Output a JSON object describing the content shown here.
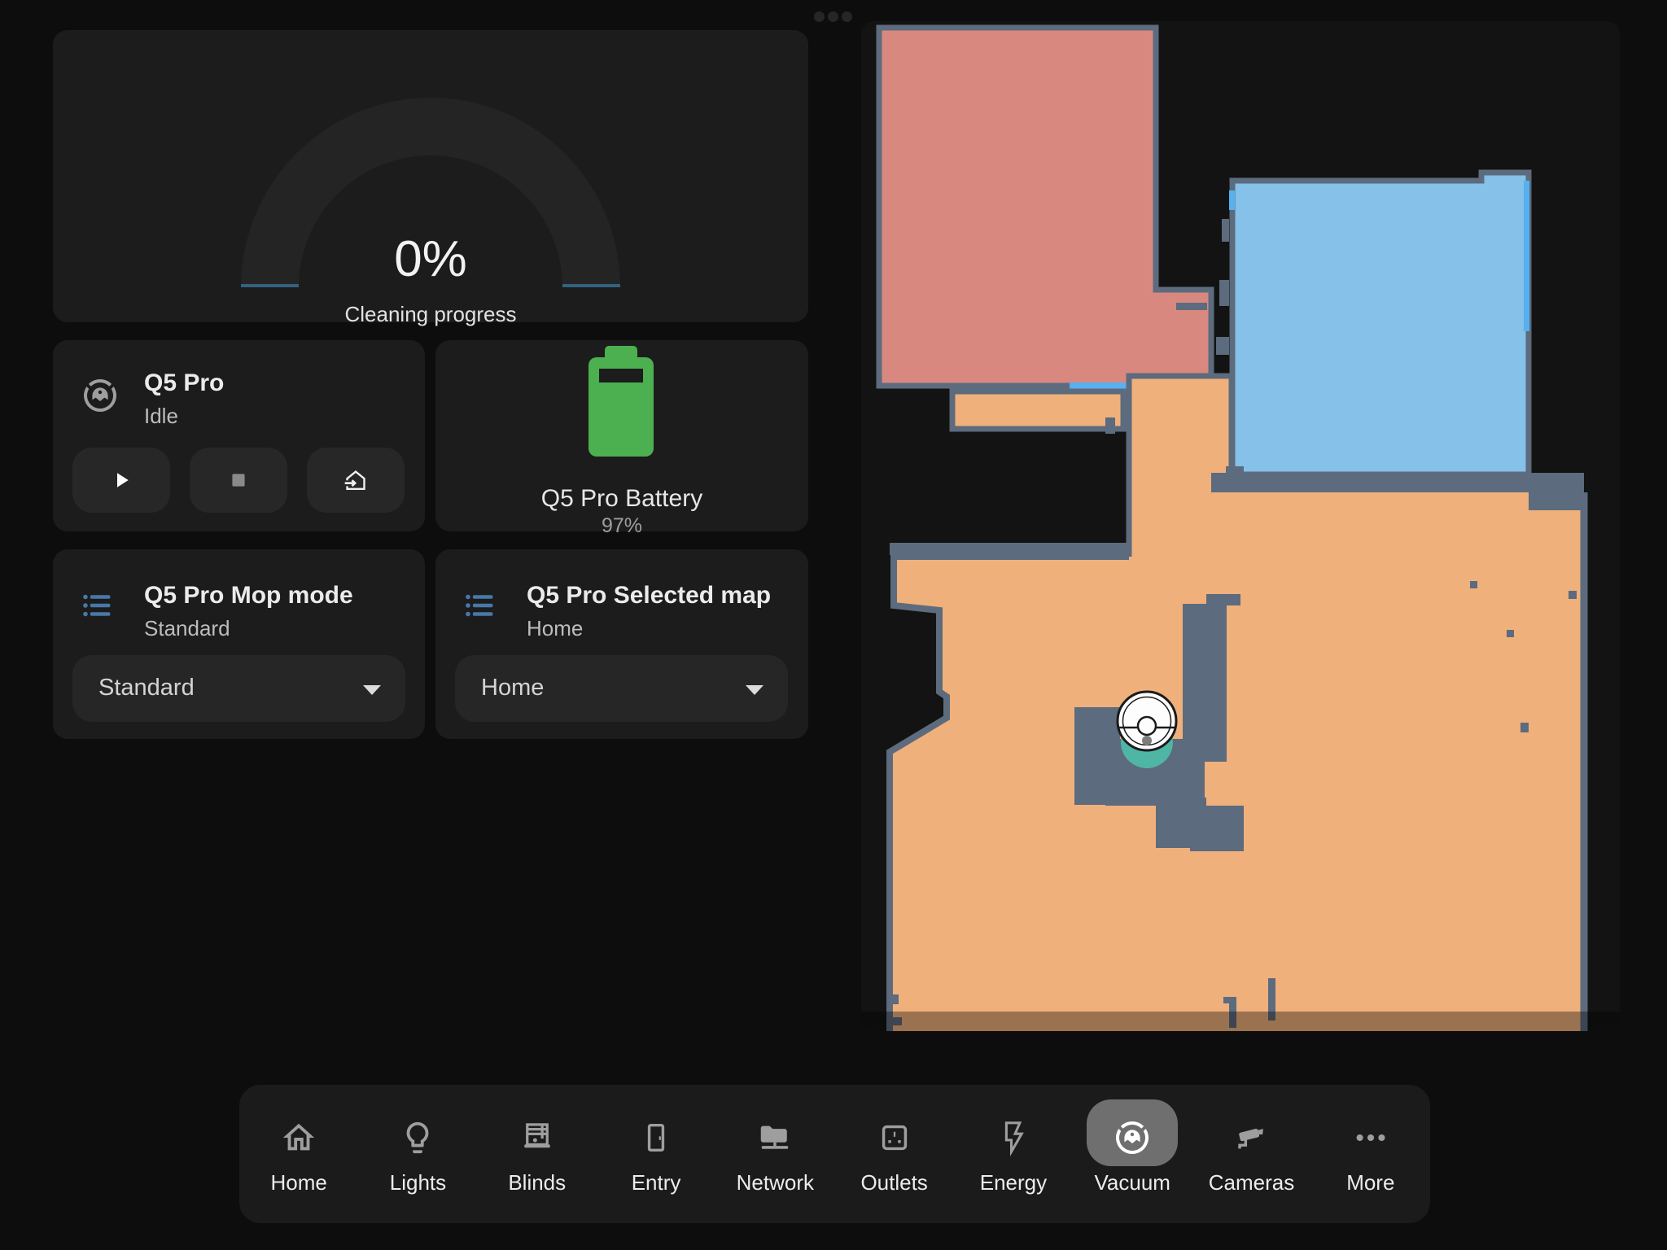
{
  "theme": {
    "page_bg": "#0d0d0d",
    "card_bg": "#1c1c1c",
    "control_bg": "#262626",
    "text_primary": "#e9e9e9",
    "text_secondary": "#bdbdbd",
    "icon_gray": "#9e9e9e"
  },
  "header": {
    "page_indicator_dots": 3
  },
  "gauge_card": {
    "value": "0%",
    "label": "Cleaning progress",
    "ring_color": "#242424",
    "accent_color": "#33627f"
  },
  "vacuum_card": {
    "name": "Q5 Pro",
    "status": "Idle",
    "controls": [
      {
        "name": "start",
        "icon": "play-icon"
      },
      {
        "name": "stop",
        "icon": "stop-icon"
      },
      {
        "name": "return-to-dock",
        "icon": "home-import-icon"
      }
    ]
  },
  "battery_card": {
    "title": "Q5 Pro Battery",
    "percentage": "97%",
    "battery_color": "#4caf50"
  },
  "mop_mode_card": {
    "title": "Q5 Pro Mop mode",
    "state": "Standard",
    "selected_option": "Standard",
    "icon": "list-icon",
    "icon_color": "#4878a8"
  },
  "selected_map_card": {
    "title": "Q5 Pro Selected map",
    "state": "Home",
    "selected_option": "Home",
    "icon": "list-icon",
    "icon_color": "#4878a8"
  },
  "map_card": {
    "background": "#131313",
    "colors": {
      "wall": "#5c6b7d",
      "room_red": "#d98880",
      "room_blue": "#85c1e9",
      "room_orange": "#efb07c",
      "dock_teal": "#4fb5a5",
      "highlight_blue": "#57b0f0"
    },
    "markers": {
      "robot": "robot-position-marker",
      "dock": "dock-marker"
    }
  },
  "nav": {
    "active_item": "Vacuum",
    "active_pill_color": "#6f6f6f",
    "items": [
      {
        "label": "Home",
        "icon": "home-icon",
        "active": false
      },
      {
        "label": "Lights",
        "icon": "lightbulb-icon",
        "active": false
      },
      {
        "label": "Blinds",
        "icon": "blinds-icon",
        "active": false
      },
      {
        "label": "Entry",
        "icon": "door-icon",
        "active": false
      },
      {
        "label": "Network",
        "icon": "folder-network-icon",
        "active": false
      },
      {
        "label": "Outlets",
        "icon": "power-socket-icon",
        "active": false
      },
      {
        "label": "Energy",
        "icon": "flash-icon",
        "active": false
      },
      {
        "label": "Vacuum",
        "icon": "robot-vacuum-icon",
        "active": true
      },
      {
        "label": "Cameras",
        "icon": "cctv-icon",
        "active": false
      },
      {
        "label": "More",
        "icon": "dots-horizontal-icon",
        "active": false
      }
    ]
  }
}
